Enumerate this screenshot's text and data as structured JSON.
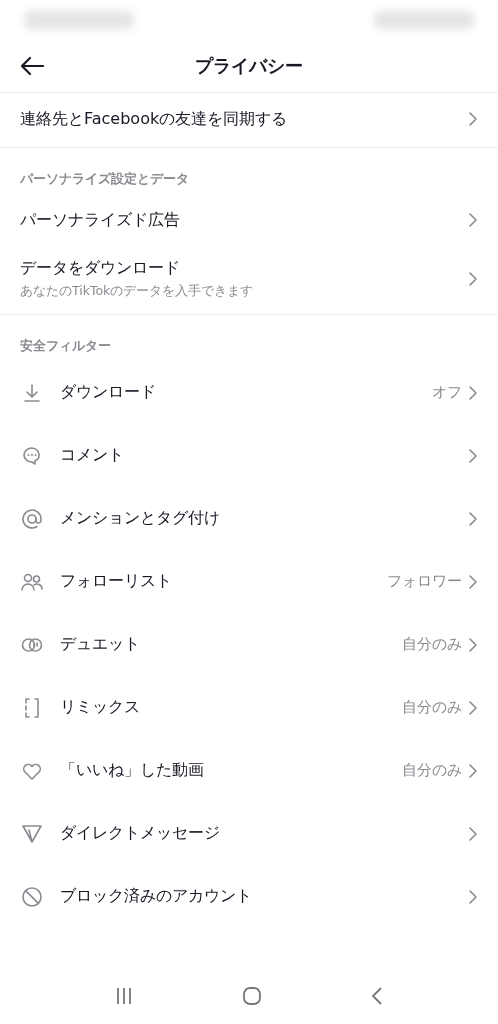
{
  "header": {
    "title": "プライバシー"
  },
  "sections": [
    {
      "items": [
        {
          "label": "連絡先とFacebookの友達を同期する"
        }
      ]
    },
    {
      "heading": "パーソナライズ設定とデータ",
      "items": [
        {
          "label": "パーソナライズド広告"
        },
        {
          "label": "データをダウンロード",
          "subtitle": "あなたのTikTokのデータを入手できます"
        }
      ]
    },
    {
      "heading": "安全フィルター",
      "items": [
        {
          "label": "ダウンロード",
          "value": "オフ"
        },
        {
          "label": "コメント"
        },
        {
          "label": "メンションとタグ付け"
        },
        {
          "label": "フォローリスト",
          "value": "フォロワー"
        },
        {
          "label": "デュエット",
          "value": "自分のみ"
        },
        {
          "label": "リミックス",
          "value": "自分のみ"
        },
        {
          "label": "「いいね」した動画",
          "value": "自分のみ"
        },
        {
          "label": "ダイレクトメッセージ"
        },
        {
          "label": "ブロック済みのアカウント"
        }
      ]
    }
  ]
}
